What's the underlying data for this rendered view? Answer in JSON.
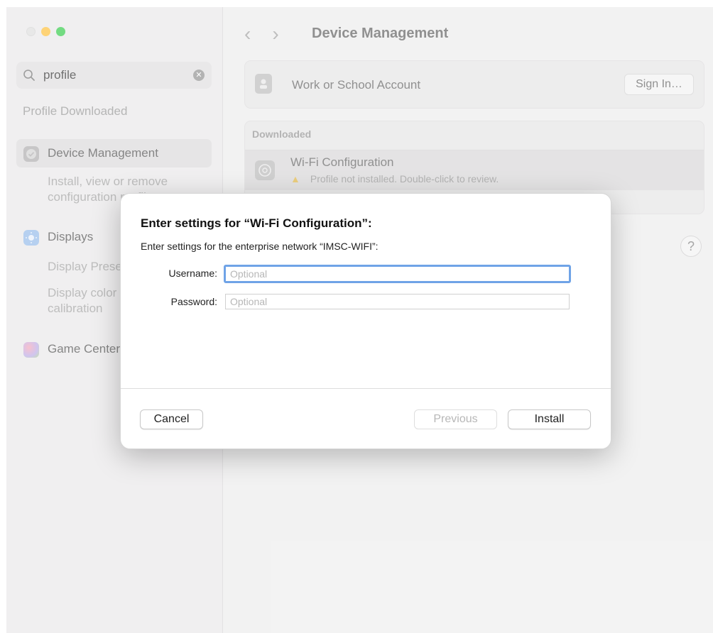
{
  "sidebar": {
    "search": {
      "value": "profile"
    },
    "result_header": "Profile Downloaded",
    "items": [
      {
        "label": "Device Management",
        "sub": "Install, view or remove configuration profiles"
      },
      {
        "label": "Displays",
        "sub1": "Display Presets",
        "sub2": "Display color calibration"
      },
      {
        "label": "Game Center"
      }
    ]
  },
  "main": {
    "title": "Device Management",
    "account": {
      "label": "Work or School Account",
      "button": "Sign In…"
    },
    "downloaded": {
      "header": "Downloaded",
      "item_title": "Wi‑Fi Configuration",
      "item_sub": "Profile not installed. Double-click to review."
    },
    "help": "?"
  },
  "dialog": {
    "title": "Enter settings for “Wi‑Fi Configuration”:",
    "subtitle": "Enter settings for the enterprise network “IMSC‑WIFI”:",
    "username_label": "Username:",
    "username_placeholder": "Optional",
    "password_label": "Password:",
    "password_placeholder": "Optional",
    "cancel": "Cancel",
    "previous": "Previous",
    "install": "Install"
  },
  "colors": {
    "focus_ring": "#6fa3e7",
    "warning": "#e0b43a",
    "traffic_min": "#febc2e",
    "traffic_max": "#28c840"
  }
}
